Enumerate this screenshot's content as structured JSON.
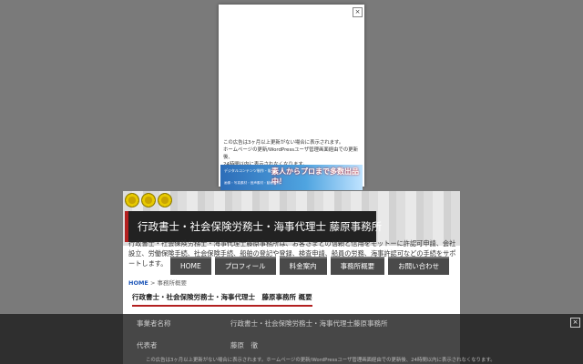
{
  "ad": {
    "close": "×",
    "note_lines": [
      "この広告は3ヶ月以上更新がない場合に表示されます。",
      "ホームページの更新/WordPressユーザ管理画面経由での更新後、",
      "24時間以内に表示されなくなります。"
    ],
    "banner_small": "デジタルコンテンツ制作・販売",
    "banner_big": "素人からプロまで多数出品中！",
    "banner_sub": "画像・写真素材・音声素材・動画素材"
  },
  "site": {
    "title": "行政書士・社会保険労務士・海事代理士 藤原事務所",
    "intro": "行政書士・社会保険労務士・海事代理士藤原事務所は、お客さまとの信頼と信用をモットーに許認可申請、会社設立、労働保険手続、社会保険手続、船舶の登記や登録、検査申請、船員の労務、海事許認可などの手続をサポートします。",
    "nav": [
      "HOME",
      "プロフィール",
      "料金案内",
      "事務所概要",
      "お問い合わせ"
    ],
    "breadcrumb_home": "HOME",
    "breadcrumb_sep": ">",
    "breadcrumb_current": "事務所概要",
    "section_title": "行政書士・社会保険労務士・海事代理士　藤原事務所 概要"
  },
  "overlay": {
    "close": "×",
    "rows": [
      {
        "label": "事業者名称",
        "value": "行政書士・社会保険労務士・海事代理士藤原事務所"
      },
      {
        "label": "代表者",
        "value": "藤原　徹"
      }
    ],
    "note": "この広告は3ヶ月以上更新がない場合に表示されます。ホームページの更新/WordPressユーザ管理画面経由での更新後、24時間以内に表示されなくなります。"
  }
}
